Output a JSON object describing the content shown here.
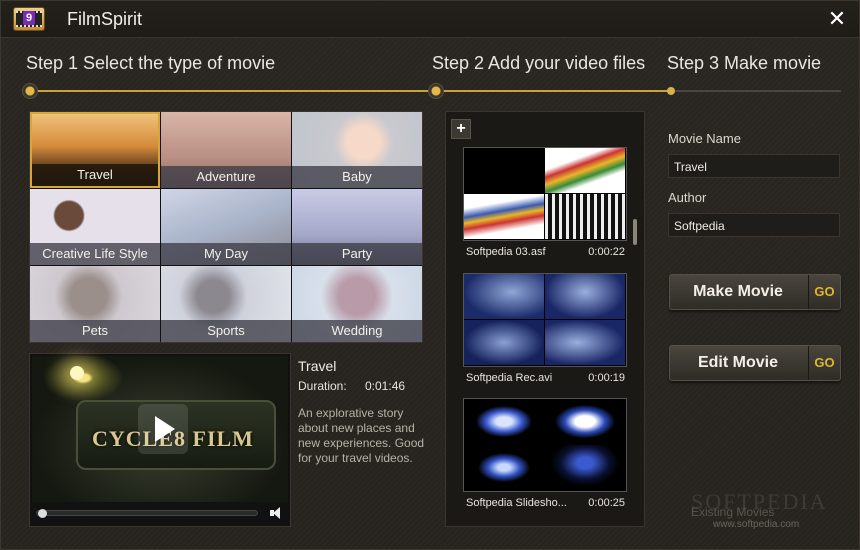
{
  "app": {
    "title": "FilmSpirit"
  },
  "steps": [
    {
      "label": "Step 1 Select the type of movie"
    },
    {
      "label": "Step 2 Add your video files"
    },
    {
      "label": "Step 3 Make movie"
    }
  ],
  "categories": [
    {
      "label": "Travel",
      "selected": true
    },
    {
      "label": "Adventure"
    },
    {
      "label": "Baby"
    },
    {
      "label": "Creative Life Style"
    },
    {
      "label": "My Day"
    },
    {
      "label": "Party"
    },
    {
      "label": "Pets"
    },
    {
      "label": "Sports"
    },
    {
      "label": "Wedding"
    }
  ],
  "preview": {
    "sign_text": "CYCLE8 FILM",
    "title": "Travel",
    "duration_label": "Duration:",
    "duration_value": "0:01:46",
    "description": "An explorative story about new places and new experiences. Good for your travel videos."
  },
  "videos": [
    {
      "name": "Softpedia 03.asf",
      "duration": "0:00:22"
    },
    {
      "name": "Softpedia Rec.avi",
      "duration": "0:00:19"
    },
    {
      "name": "Softpedia Slidesho...",
      "duration": "0:00:25"
    }
  ],
  "form": {
    "movie_name_label": "Movie Name",
    "movie_name_value": "Travel",
    "author_label": "Author",
    "author_value": "Softpedia"
  },
  "buttons": {
    "make_movie": "Make Movie",
    "edit_movie": "Edit Movie",
    "go": "GO",
    "add": "+"
  },
  "footer": {
    "existing_movies": "Existing Movies",
    "watermark": "SOFTPEDIA",
    "watermark_url": "www.softpedia.com"
  },
  "colors": {
    "accent": "#d7a637",
    "go": "#e0b62b",
    "background": "#27241f"
  }
}
